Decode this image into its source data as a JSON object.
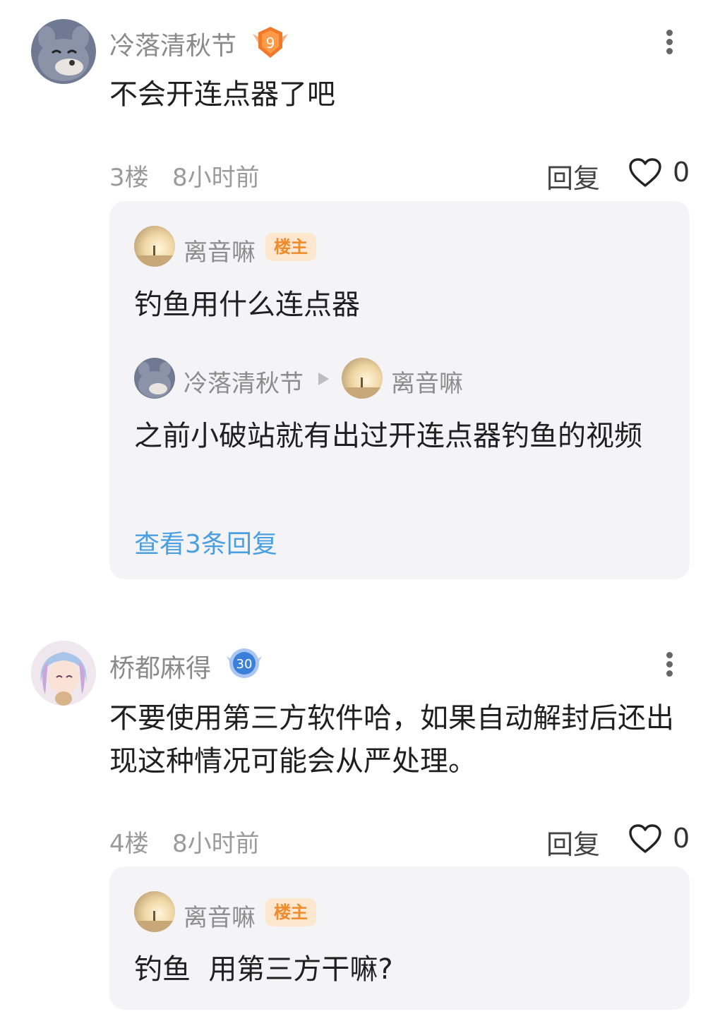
{
  "posts": [
    {
      "username": "冷落清秋节",
      "level": "9",
      "content": "不会开连点器了吧",
      "floor": "3楼",
      "time": "8小时前",
      "reply_label": "回复",
      "likes": "0",
      "replies": {
        "first": {
          "username": "离音嘛",
          "tag": "楼主",
          "content": "钓鱼用什么连点器"
        },
        "second": {
          "from": "冷落清秋节",
          "to": "离音嘛",
          "content": "之前小破站就有出过开连点器钓鱼的视频"
        },
        "view_more": "查看3条回复"
      }
    },
    {
      "username": "桥都麻得",
      "level": "30",
      "content": "不要使用第三方软件哈，如果自动解封后还出现这种情况可能会从严处理。",
      "floor": "4楼",
      "time": "8小时前",
      "reply_label": "回复",
      "likes": "0",
      "replies": {
        "first": {
          "username": "离音嘛",
          "tag": "楼主",
          "content": "钓鱼  用第三方干嘛?"
        }
      }
    }
  ],
  "icons": {
    "more": "more-vertical-icon",
    "like": "heart-outline-icon",
    "reply_arrow": "triangle-right-icon"
  },
  "colors": {
    "link": "#4a9fe0",
    "op_tag_text": "#f08a2a",
    "op_tag_bg": "#fde8cf",
    "level_9_badge": "#f07a2a",
    "level_30_badge": "#3a7fd8"
  }
}
